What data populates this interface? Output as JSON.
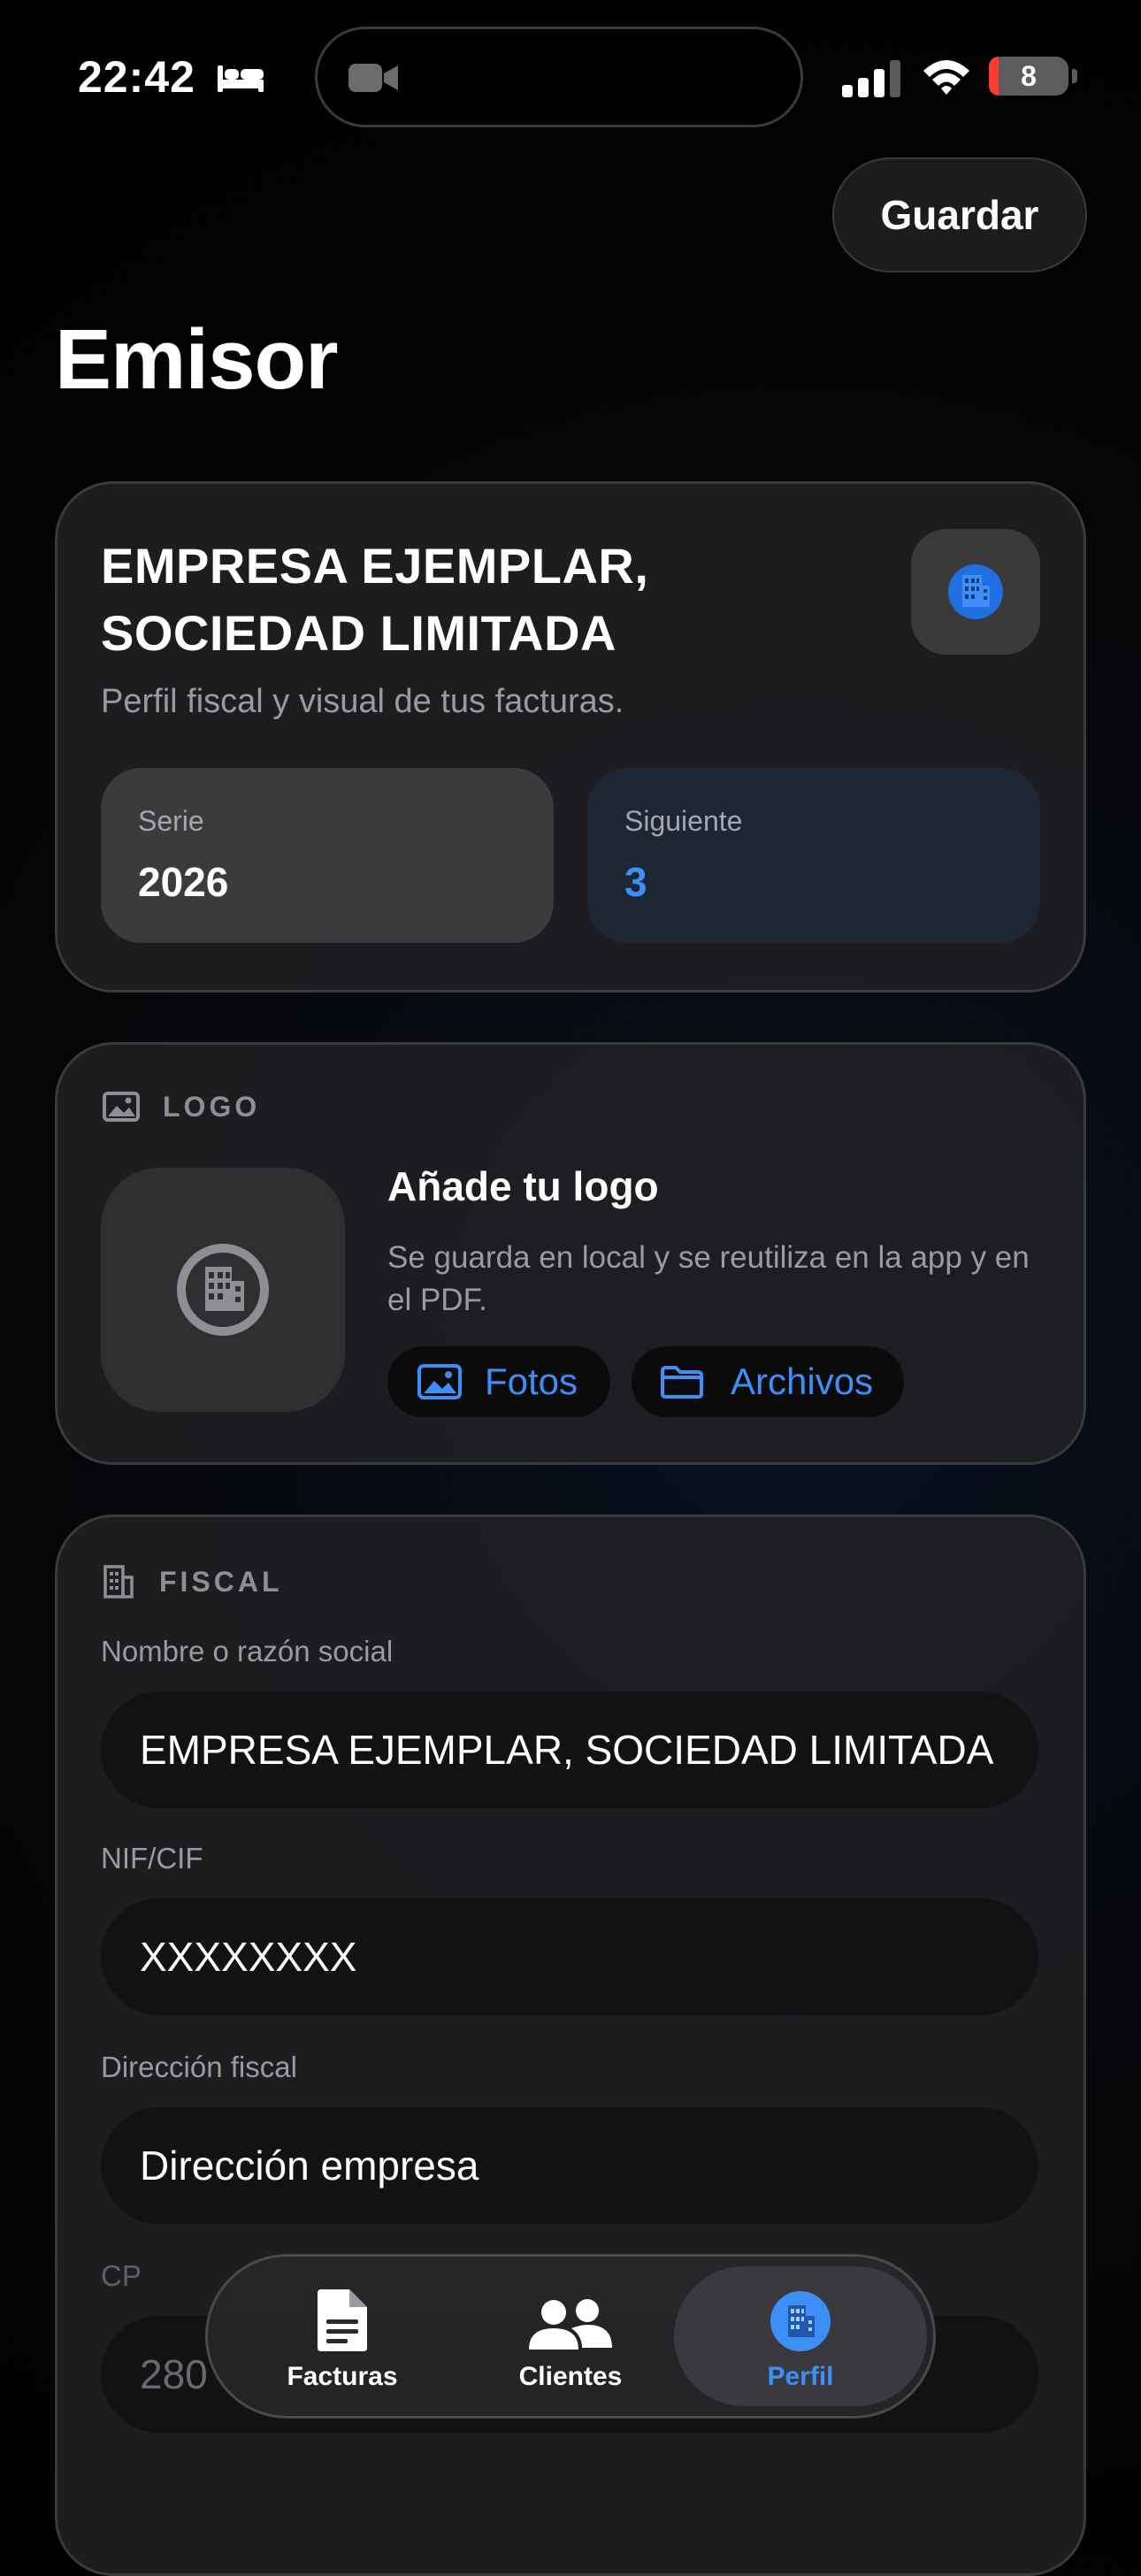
{
  "status_bar": {
    "time": "22:42",
    "battery": "8",
    "battery_color": "#ff3b30"
  },
  "toolbar": {
    "save_label": "Guardar"
  },
  "page": {
    "title": "Emisor"
  },
  "summary_card": {
    "company_name": "EMPRESA EJEMPLAR, SOCIEDAD LIMITADA",
    "subtitle": "Perfil fiscal y visual de tus facturas.",
    "serie_label": "Serie",
    "serie_value": "2026",
    "next_label": "Siguiente",
    "next_value": "3",
    "icon": "building-icon"
  },
  "logo_section": {
    "label": "LOGO",
    "heading": "Añade tu logo",
    "description": "Se guarda en local y se reutiliza en la app y en el PDF.",
    "photos_label": "Fotos",
    "files_label": "Archivos"
  },
  "fiscal_section": {
    "label": "FISCAL",
    "fields": [
      {
        "label": "Nombre o razón social",
        "value": "EMPRESA EJEMPLAR, SOCIEDAD LIMITADA"
      },
      {
        "label": "NIF/CIF",
        "value": "XXXXXXXX"
      },
      {
        "label": "Dirección fiscal",
        "value": "Dirección empresa"
      },
      {
        "label": "CP",
        "value": "280"
      }
    ]
  },
  "tab_bar": {
    "tabs": [
      {
        "label": "Facturas",
        "icon": "document-icon",
        "active": false
      },
      {
        "label": "Clientes",
        "icon": "people-icon",
        "active": false
      },
      {
        "label": "Perfil",
        "icon": "building-icon",
        "active": true
      }
    ]
  },
  "colors": {
    "accent": "#3d8ef5",
    "background": "#000000",
    "card": "#202023"
  }
}
